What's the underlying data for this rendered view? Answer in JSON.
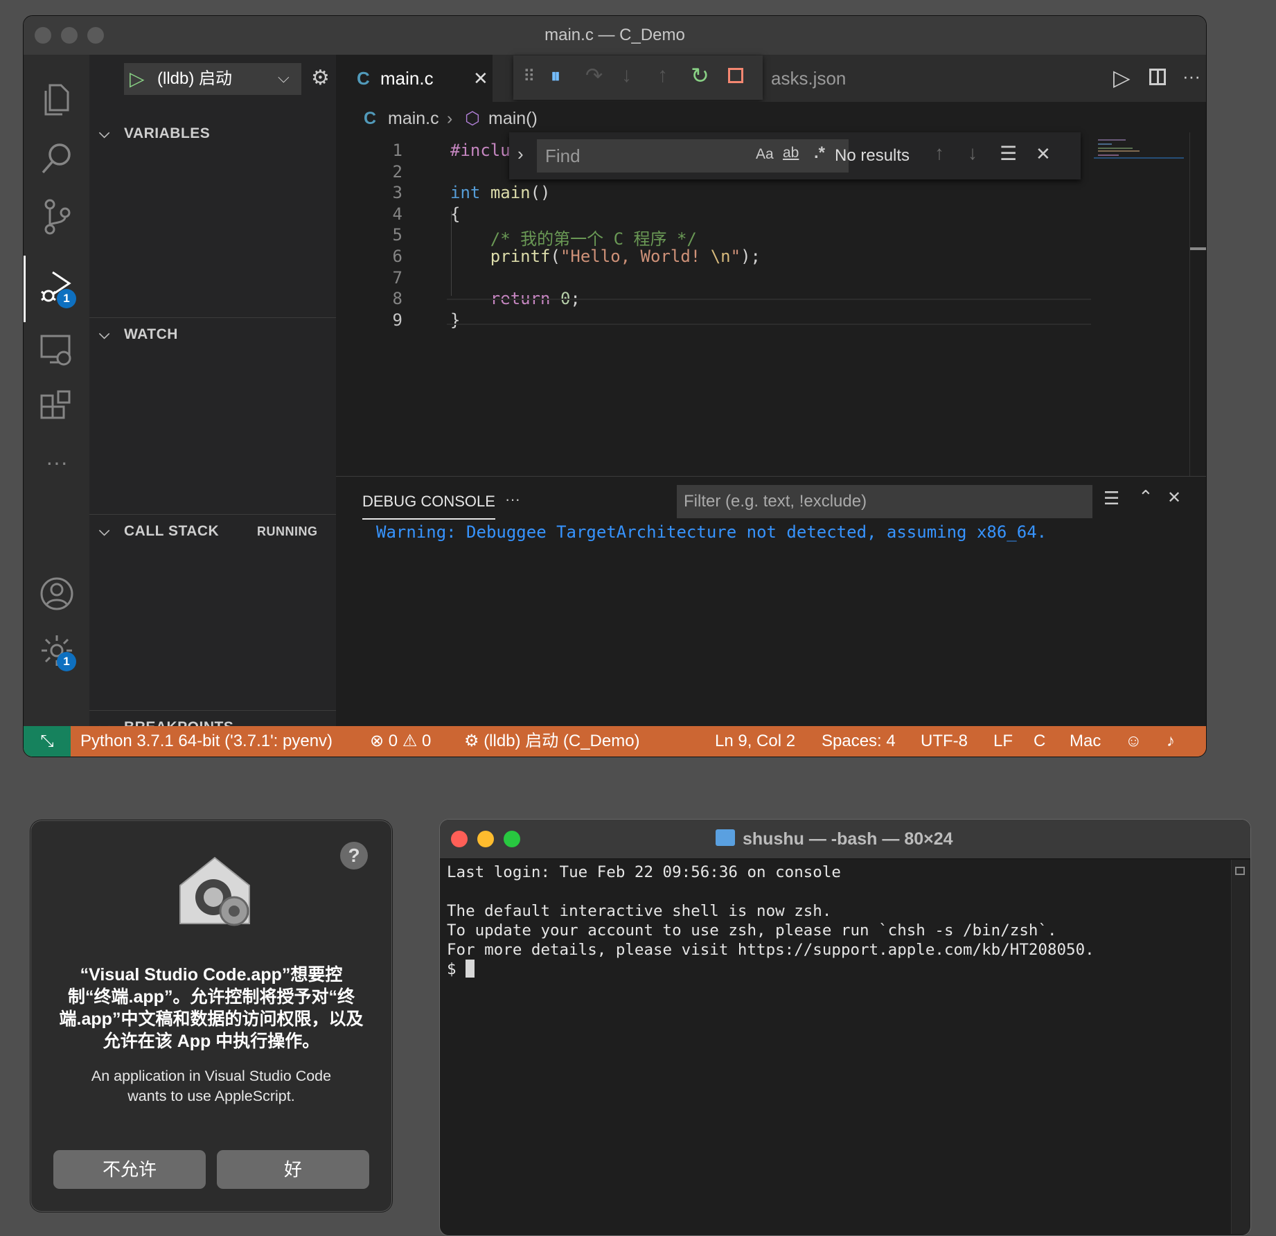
{
  "vscode": {
    "window_title": "main.c — C_Demo",
    "activity_bar": {
      "icons": [
        "explorer-icon",
        "search-icon",
        "source-control-icon",
        "run-debug-icon",
        "remote-explorer-icon",
        "extensions-icon",
        "more-icon",
        "account-icon",
        "manage-gear-icon"
      ],
      "run_debug_badge": "1",
      "manage_badge": "1"
    },
    "sidebar": {
      "launch_config": "(lldb) 启动",
      "sections": {
        "variables": "VARIABLES",
        "watch": "WATCH",
        "call_stack": "CALL STACK",
        "call_stack_status": "RUNNING",
        "breakpoints": "BREAKPOINTS"
      }
    },
    "tabs": [
      {
        "icon": "C",
        "label": "main.c",
        "active": true
      },
      {
        "label": "asks.json",
        "active": false
      }
    ],
    "breadcrumb": {
      "file_icon": "C",
      "file": "main.c",
      "symbol": "main()"
    },
    "code_lines": [
      {
        "n": "1",
        "tokens": [
          {
            "t": "#inclu",
            "c": "#c586c0"
          }
        ]
      },
      {
        "n": "2",
        "tokens": []
      },
      {
        "n": "3",
        "tokens": [
          {
            "t": "int",
            "c": "#569cd6"
          },
          {
            "t": " ",
            "c": "#d4d4d4"
          },
          {
            "t": "main",
            "c": "#dcdcaa"
          },
          {
            "t": "()",
            "c": "#d4d4d4"
          }
        ]
      },
      {
        "n": "4",
        "tokens": [
          {
            "t": "{",
            "c": "#d4d4d4"
          }
        ]
      },
      {
        "n": "5",
        "tokens": [
          {
            "t": "    /* 我的第一个 C 程序 */",
            "c": "#6a9955"
          }
        ]
      },
      {
        "n": "6",
        "tokens": [
          {
            "t": "    ",
            "c": "#d4d4d4"
          },
          {
            "t": "printf",
            "c": "#dcdcaa"
          },
          {
            "t": "(",
            "c": "#d4d4d4"
          },
          {
            "t": "\"Hello, World! ",
            "c": "#ce9178"
          },
          {
            "t": "\\n",
            "c": "#d7ba7d"
          },
          {
            "t": "\"",
            "c": "#ce9178"
          },
          {
            "t": ");",
            "c": "#d4d4d4"
          }
        ]
      },
      {
        "n": "7",
        "tokens": []
      },
      {
        "n": "8",
        "tokens": [
          {
            "t": "    ",
            "c": "#d4d4d4"
          },
          {
            "t": "return",
            "c": "#c586c0"
          },
          {
            "t": " ",
            "c": "#d4d4d4"
          },
          {
            "t": "0",
            "c": "#b5cea8"
          },
          {
            "t": ";",
            "c": "#d4d4d4"
          }
        ]
      },
      {
        "n": "9",
        "tokens": [
          {
            "t": "}",
            "c": "#d4d4d4"
          }
        ]
      }
    ],
    "find_widget": {
      "placeholder": "Find",
      "match_case": "Aa",
      "whole_word": "ab",
      "regex": ".*",
      "result": "No results"
    },
    "panel": {
      "tab": "DEBUG CONSOLE",
      "more": "···",
      "filter_placeholder": "Filter (e.g. text, !exclude)",
      "output": "Warning: Debuggee TargetArchitecture not detected, assuming x86_64.",
      "prompt": ">"
    },
    "status_bar": {
      "python": "Python 3.7.1 64-bit ('3.7.1': pyenv)",
      "errors": "0",
      "warnings": "0",
      "debug_session": "(lldb) 启动 (C_Demo)",
      "position": "Ln 9, Col 2",
      "spaces": "Spaces: 4",
      "encoding": "UTF-8",
      "eol": "LF",
      "language": "C",
      "platform": "Mac"
    }
  },
  "dialog": {
    "help": "?",
    "title": "“Visual Studio Code.app”想要控制“终端.app”。允许控制将授予对“终端.app”中文稿和数据的访问权限，以及允许在该 App 中执行操作。",
    "message": "An application in Visual Studio Code wants to use AppleScript.",
    "deny_button": "不允许",
    "ok_button": "好"
  },
  "terminal": {
    "title": "shushu — -bash — 80×24",
    "lines": [
      "Last login: Tue Feb 22 09:56:36 on console",
      "",
      "The default interactive shell is now zsh.",
      "To update your account to use zsh, please run `chsh -s /bin/zsh`.",
      "For more details, please visit https://support.apple.com/kb/HT208050.",
      "$ "
    ],
    "traffic_colors": [
      "#ff5f57",
      "#febc2e",
      "#28c840"
    ]
  }
}
